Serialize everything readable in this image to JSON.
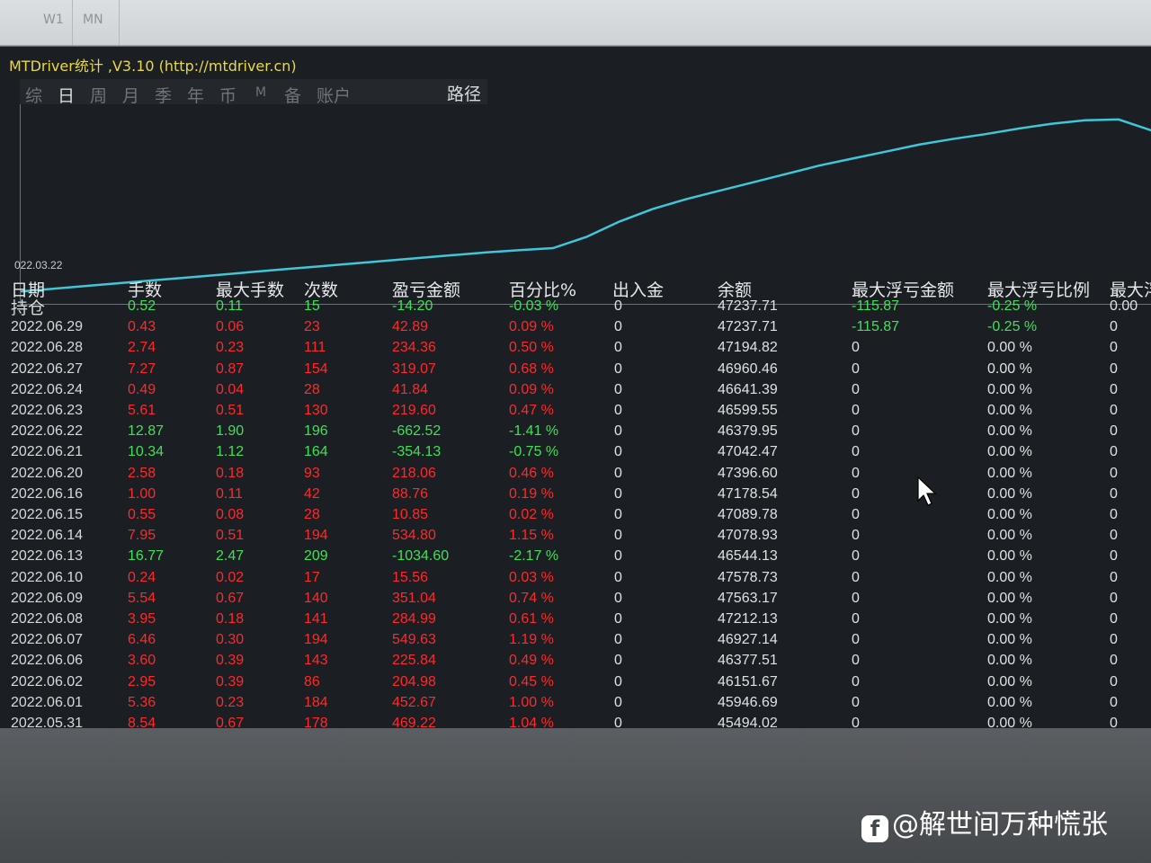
{
  "toolbar": {
    "tabs": [
      "W1",
      "MN"
    ]
  },
  "window": {
    "title": "MTDriver统计 ,V3.10 (http://mtdriver.cn)",
    "tabs": [
      "综",
      "日",
      "周",
      "月",
      "季",
      "年",
      "币",
      "M",
      "备",
      "账户"
    ],
    "active_tab": "日",
    "path_tab": "路径"
  },
  "chart_data": {
    "type": "line",
    "x_start_label": "022.03.22",
    "color": "#3fc6d8",
    "series": [
      {
        "values": [
          100,
          104,
          108,
          112,
          116,
          120,
          124,
          128,
          132,
          136,
          140,
          144,
          148,
          152,
          156,
          159,
          162,
          178,
          200,
          218,
          232,
          244,
          256,
          268,
          280,
          290,
          300,
          310,
          318,
          325,
          333,
          340,
          345,
          346,
          330
        ]
      }
    ]
  },
  "table": {
    "columns": [
      "日期",
      "手数",
      "最大手数",
      "次数",
      "盈亏金额",
      "百分比%",
      "出入金",
      "余额",
      "最大浮亏金额",
      "最大浮亏比例",
      "最大浮"
    ],
    "rows": [
      {
        "date": "持仓",
        "lots": "0.52",
        "max_lots": "0.11",
        "count": "15",
        "pnl": "-14.20",
        "pct": "-0.03 %",
        "io": "0",
        "balance": "47237.71",
        "max_dd": "-115.87",
        "max_dd_pct": "-0.25 %",
        "last": "0.00",
        "color": "green",
        "dd_color": "green"
      },
      {
        "date": "2022.06.29",
        "lots": "0.43",
        "max_lots": "0.06",
        "count": "23",
        "pnl": "42.89",
        "pct": "0.09 %",
        "io": "0",
        "balance": "47237.71",
        "max_dd": "-115.87",
        "max_dd_pct": "-0.25 %",
        "last": "0",
        "color": "red",
        "dd_color": "green"
      },
      {
        "date": "2022.06.28",
        "lots": "2.74",
        "max_lots": "0.23",
        "count": "111",
        "pnl": "234.36",
        "pct": "0.50 %",
        "io": "0",
        "balance": "47194.82",
        "max_dd": "0",
        "max_dd_pct": "0.00 %",
        "last": "0",
        "color": "red",
        "dd_color": "white"
      },
      {
        "date": "2022.06.27",
        "lots": "7.27",
        "max_lots": "0.87",
        "count": "154",
        "pnl": "319.07",
        "pct": "0.68 %",
        "io": "0",
        "balance": "46960.46",
        "max_dd": "0",
        "max_dd_pct": "0.00 %",
        "last": "0",
        "color": "red",
        "dd_color": "white"
      },
      {
        "date": "2022.06.24",
        "lots": "0.49",
        "max_lots": "0.04",
        "count": "28",
        "pnl": "41.84",
        "pct": "0.09 %",
        "io": "0",
        "balance": "46641.39",
        "max_dd": "0",
        "max_dd_pct": "0.00 %",
        "last": "0",
        "color": "red",
        "dd_color": "white"
      },
      {
        "date": "2022.06.23",
        "lots": "5.61",
        "max_lots": "0.51",
        "count": "130",
        "pnl": "219.60",
        "pct": "0.47 %",
        "io": "0",
        "balance": "46599.55",
        "max_dd": "0",
        "max_dd_pct": "0.00 %",
        "last": "0",
        "color": "red",
        "dd_color": "white"
      },
      {
        "date": "2022.06.22",
        "lots": "12.87",
        "max_lots": "1.90",
        "count": "196",
        "pnl": "-662.52",
        "pct": "-1.41 %",
        "io": "0",
        "balance": "46379.95",
        "max_dd": "0",
        "max_dd_pct": "0.00 %",
        "last": "0",
        "color": "green",
        "dd_color": "white"
      },
      {
        "date": "2022.06.21",
        "lots": "10.34",
        "max_lots": "1.12",
        "count": "164",
        "pnl": "-354.13",
        "pct": "-0.75 %",
        "io": "0",
        "balance": "47042.47",
        "max_dd": "0",
        "max_dd_pct": "0.00 %",
        "last": "0",
        "color": "green",
        "dd_color": "white"
      },
      {
        "date": "2022.06.20",
        "lots": "2.58",
        "max_lots": "0.18",
        "count": "93",
        "pnl": "218.06",
        "pct": "0.46 %",
        "io": "0",
        "balance": "47396.60",
        "max_dd": "0",
        "max_dd_pct": "0.00 %",
        "last": "0",
        "color": "red",
        "dd_color": "white"
      },
      {
        "date": "2022.06.16",
        "lots": "1.00",
        "max_lots": "0.11",
        "count": "42",
        "pnl": "88.76",
        "pct": "0.19 %",
        "io": "0",
        "balance": "47178.54",
        "max_dd": "0",
        "max_dd_pct": "0.00 %",
        "last": "0",
        "color": "red",
        "dd_color": "white"
      },
      {
        "date": "2022.06.15",
        "lots": "0.55",
        "max_lots": "0.08",
        "count": "28",
        "pnl": "10.85",
        "pct": "0.02 %",
        "io": "0",
        "balance": "47089.78",
        "max_dd": "0",
        "max_dd_pct": "0.00 %",
        "last": "0",
        "color": "red",
        "dd_color": "white"
      },
      {
        "date": "2022.06.14",
        "lots": "7.95",
        "max_lots": "0.51",
        "count": "194",
        "pnl": "534.80",
        "pct": "1.15 %",
        "io": "0",
        "balance": "47078.93",
        "max_dd": "0",
        "max_dd_pct": "0.00 %",
        "last": "0",
        "color": "red",
        "dd_color": "white"
      },
      {
        "date": "2022.06.13",
        "lots": "16.77",
        "max_lots": "2.47",
        "count": "209",
        "pnl": "-1034.60",
        "pct": "-2.17 %",
        "io": "0",
        "balance": "46544.13",
        "max_dd": "0",
        "max_dd_pct": "0.00 %",
        "last": "0",
        "color": "green",
        "dd_color": "white"
      },
      {
        "date": "2022.06.10",
        "lots": "0.24",
        "max_lots": "0.02",
        "count": "17",
        "pnl": "15.56",
        "pct": "0.03 %",
        "io": "0",
        "balance": "47578.73",
        "max_dd": "0",
        "max_dd_pct": "0.00 %",
        "last": "0",
        "color": "red",
        "dd_color": "white"
      },
      {
        "date": "2022.06.09",
        "lots": "5.54",
        "max_lots": "0.67",
        "count": "140",
        "pnl": "351.04",
        "pct": "0.74 %",
        "io": "0",
        "balance": "47563.17",
        "max_dd": "0",
        "max_dd_pct": "0.00 %",
        "last": "0",
        "color": "red",
        "dd_color": "white"
      },
      {
        "date": "2022.06.08",
        "lots": "3.95",
        "max_lots": "0.18",
        "count": "141",
        "pnl": "284.99",
        "pct": "0.61 %",
        "io": "0",
        "balance": "47212.13",
        "max_dd": "0",
        "max_dd_pct": "0.00 %",
        "last": "0",
        "color": "red",
        "dd_color": "white"
      },
      {
        "date": "2022.06.07",
        "lots": "6.46",
        "max_lots": "0.30",
        "count": "194",
        "pnl": "549.63",
        "pct": "1.19 %",
        "io": "0",
        "balance": "46927.14",
        "max_dd": "0",
        "max_dd_pct": "0.00 %",
        "last": "0",
        "color": "red",
        "dd_color": "white"
      },
      {
        "date": "2022.06.06",
        "lots": "3.60",
        "max_lots": "0.39",
        "count": "143",
        "pnl": "225.84",
        "pct": "0.49 %",
        "io": "0",
        "balance": "46377.51",
        "max_dd": "0",
        "max_dd_pct": "0.00 %",
        "last": "0",
        "color": "red",
        "dd_color": "white"
      },
      {
        "date": "2022.06.02",
        "lots": "2.95",
        "max_lots": "0.39",
        "count": "86",
        "pnl": "204.98",
        "pct": "0.45 %",
        "io": "0",
        "balance": "46151.67",
        "max_dd": "0",
        "max_dd_pct": "0.00 %",
        "last": "0",
        "color": "red",
        "dd_color": "white"
      },
      {
        "date": "2022.06.01",
        "lots": "5.36",
        "max_lots": "0.23",
        "count": "184",
        "pnl": "452.67",
        "pct": "1.00 %",
        "io": "0",
        "balance": "45946.69",
        "max_dd": "0",
        "max_dd_pct": "0.00 %",
        "last": "0",
        "color": "red",
        "dd_color": "white"
      },
      {
        "date": "2022.05.31",
        "lots": "8.54",
        "max_lots": "0.67",
        "count": "178",
        "pnl": "469.22",
        "pct": "1.04 %",
        "io": "0",
        "balance": "45494.02",
        "max_dd": "0",
        "max_dd_pct": "0.00 %",
        "last": "0",
        "color": "red",
        "dd_color": "white"
      }
    ]
  },
  "watermark": {
    "text": "@解世间万种慌张"
  },
  "colors": {
    "profit": "#ff2a2a",
    "loss": "#42e05a",
    "title": "#e8d84a",
    "line": "#3fc6d8"
  }
}
